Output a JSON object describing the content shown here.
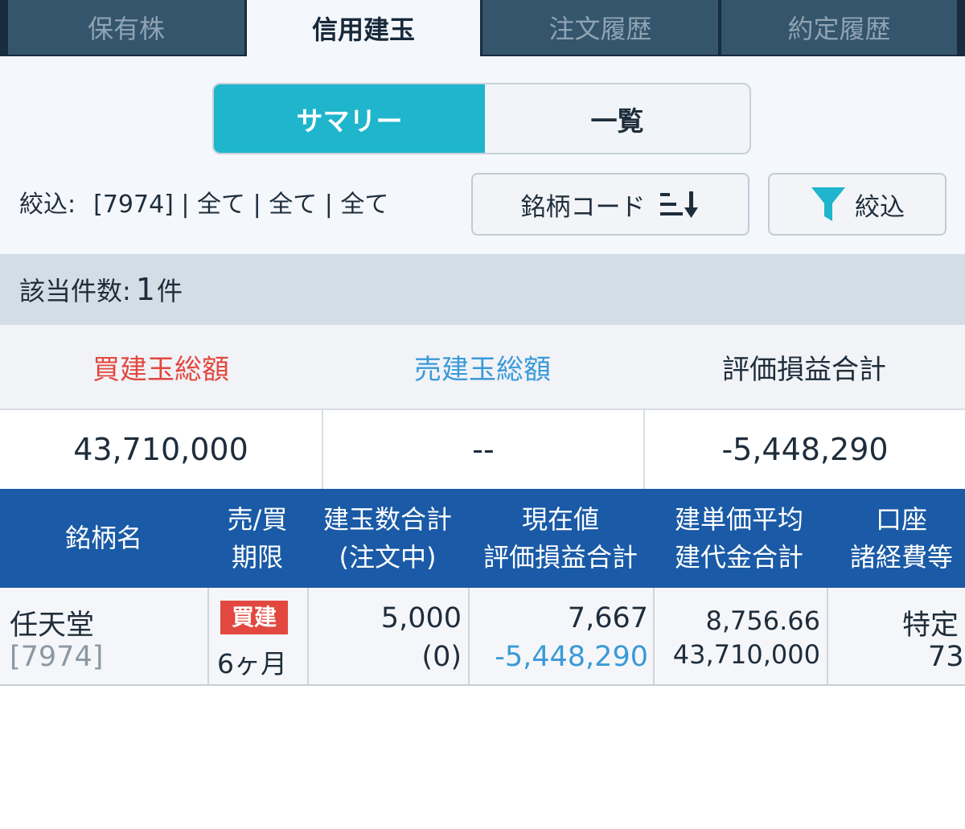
{
  "tabs": [
    "保有株",
    "信用建玉",
    "注文履歴",
    "約定履歴"
  ],
  "segment": {
    "summary": "サマリー",
    "list": "一覧"
  },
  "filter": {
    "label": "絞込:",
    "value": "[7974] | 全て | 全て | 全て"
  },
  "sort_button": {
    "label": "銘柄コード",
    "icon": "sort-descending-icon"
  },
  "filter_button": {
    "label": "絞込",
    "icon": "funnel-icon"
  },
  "count": {
    "prefix": "該当件数:",
    "value": "1",
    "suffix": "件"
  },
  "summary": {
    "headers": [
      "買建玉総額",
      "売建玉総額",
      "評価損益合計"
    ],
    "values": [
      "43,710,000",
      "--",
      "-5,448,290"
    ]
  },
  "table": {
    "headers": [
      [
        "銘柄名"
      ],
      [
        "売/買",
        "期限"
      ],
      [
        "建玉数合計",
        "(注文中)"
      ],
      [
        "現在値",
        "評価損益合計"
      ],
      [
        "建単価平均",
        "建代金合計"
      ],
      [
        "口座",
        "諸経費等"
      ]
    ],
    "row": {
      "name": "任天堂",
      "code": "[7974]",
      "side": "買建",
      "term": "6ヶ月",
      "qty": "5,000",
      "qty_pending": "(0)",
      "price": "7,667",
      "pnl": "-5,448,290",
      "avg_price": "8,756.66",
      "total_cost": "43,710,000",
      "account": "特定",
      "fees": "73"
    }
  },
  "colors": {
    "accent": "#1fb5cc",
    "header_blue": "#1a5aa6",
    "buy_red": "#e2483f",
    "sell_blue": "#3a9ad8"
  }
}
